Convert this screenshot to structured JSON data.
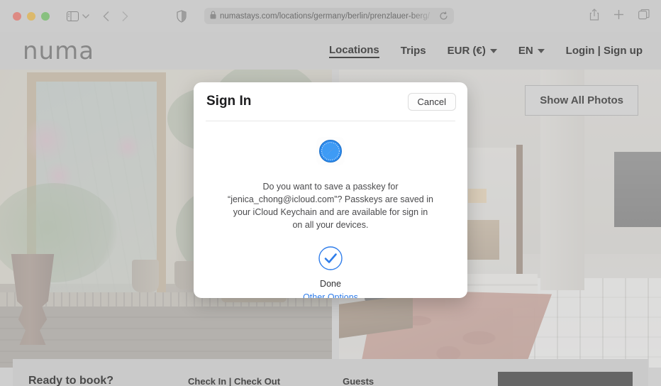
{
  "browser": {
    "traffic_lights": [
      "close-red",
      "minimize-yellow",
      "zoom-green"
    ],
    "sidebar_icon": "sidebar-icon",
    "chevron_icon": "chevron-down-icon",
    "back_icon": "back-chevron-icon",
    "forward_icon": "forward-chevron-icon",
    "shield_icon": "privacy-shield-icon",
    "lock_icon": "lock-icon",
    "url": "numastays.com/locations/germany/berlin/prenzlauer-berg/",
    "reload_icon": "reload-icon",
    "share_icon": "share-icon",
    "new_tab_icon": "plus-icon",
    "tabs_icon": "tab-overview-icon"
  },
  "site": {
    "logo": "numa",
    "nav": [
      {
        "label": "Locations",
        "active": true,
        "caret": false
      },
      {
        "label": "Trips",
        "active": false,
        "caret": false
      },
      {
        "label": "EUR (€)",
        "active": false,
        "caret": true
      },
      {
        "label": "EN",
        "active": false,
        "caret": true
      },
      {
        "label": "Login | Sign up",
        "active": false,
        "caret": false
      }
    ],
    "show_all_photos": "Show All Photos"
  },
  "booking": {
    "title": "Ready to book?",
    "dates_label": "Check In | Check Out",
    "guests_label": "Guests",
    "submit_label": ""
  },
  "dialog": {
    "title": "Sign In",
    "cancel_label": "Cancel",
    "app_icon": "safari-compass-icon",
    "message": "Do you want to save a passkey for “jenica_chong@icloud.com”? Passkeys are saved in your iCloud Keychain and are available for sign in on all your devices.",
    "status_icon": "checkmark-circle-icon",
    "done_label": "Done",
    "other_options_label": "Other Options"
  },
  "colors": {
    "accent_blue": "#2f7dea",
    "dialog_bg": "#ffffff",
    "chrome_bg": "#cccccc",
    "button_dark": "#666666"
  }
}
